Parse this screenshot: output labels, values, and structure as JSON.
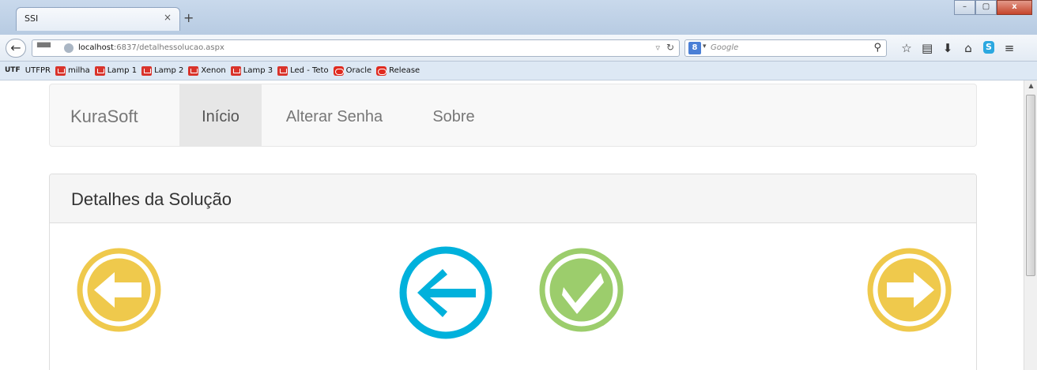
{
  "browser": {
    "tab_title": "SSI",
    "tab_close": "×",
    "new_tab": "+",
    "window_buttons": {
      "minimize": "–",
      "maximize": "▢",
      "close": "x"
    },
    "url_host": "localhost",
    "url_rest": ":6837/detalhessolucao.aspx",
    "search_engine": "8",
    "search_placeholder": "Google",
    "bookmarks": [
      {
        "label": "UTFPR",
        "icon": "utf-logo-icon",
        "prefix": "UTF"
      },
      {
        "label": "milha",
        "icon": "cart-icon"
      },
      {
        "label": "Lamp 1",
        "icon": "cart-icon"
      },
      {
        "label": "Lamp 2",
        "icon": "cart-icon"
      },
      {
        "label": "Xenon",
        "icon": "cart-icon"
      },
      {
        "label": "Lamp 3",
        "icon": "cart-icon"
      },
      {
        "label": "Led - Teto",
        "icon": "cart-icon"
      },
      {
        "label": "Oracle",
        "icon": "oracle-icon"
      },
      {
        "label": "Release",
        "icon": "oracle-icon"
      }
    ]
  },
  "nav": {
    "brand": "KuraSoft",
    "items": [
      {
        "label": "Início",
        "active": true
      },
      {
        "label": "Alterar Senha",
        "active": false
      },
      {
        "label": "Sobre",
        "active": false
      }
    ]
  },
  "panel": {
    "title": "Detalhes da Solução",
    "buttons": [
      {
        "name": "previous-button",
        "icon": "arrow-left-circle-icon",
        "color": "#efc94c"
      },
      {
        "name": "back-button",
        "icon": "arrow-left-circle-icon",
        "color": "#00b1dc"
      },
      {
        "name": "confirm-button",
        "icon": "checkmark-circle-icon",
        "color": "#9ccd6c"
      },
      {
        "name": "next-button",
        "icon": "arrow-right-circle-icon",
        "color": "#efc94c"
      }
    ]
  }
}
